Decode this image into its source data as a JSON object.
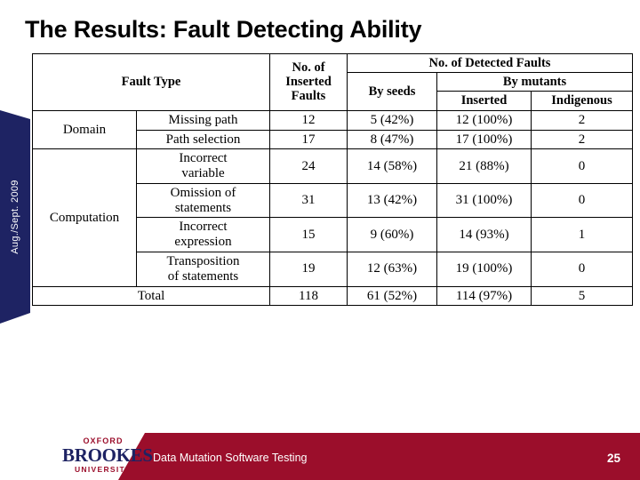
{
  "slide": {
    "title": "The Results: Fault Detecting Ability",
    "side_banner_label": "Aug./Sept. 2009",
    "page_number": "25"
  },
  "footer": {
    "text": "Data Mutation Software Testing",
    "logo_line1": "OXFORD",
    "logo_line2": "BROOKES",
    "logo_line3": "UNIVERSITY",
    "band_color": "#9b0e2b",
    "logo_navy": "#1e2363"
  },
  "chart_data": {
    "type": "table",
    "title": "The Results: Fault Detecting Ability",
    "headers": {
      "fault_type": "Fault Type",
      "inserted_faults": "No. of Inserted Faults",
      "inserted_faults_l1": "No. of",
      "inserted_faults_l2": "Inserted",
      "inserted_faults_l3": "Faults",
      "detected_faults": "No. of Detected Faults",
      "by_seeds": "By seeds",
      "by_mutants": "By mutants",
      "mutants_inserted": "Inserted",
      "mutants_indigenous": "Indigenous"
    },
    "columns": [
      "Fault Type Category",
      "Fault Type",
      "No. of Inserted Faults",
      "By seeds",
      "By mutants - Inserted",
      "By mutants - Indigenous"
    ],
    "rows": [
      {
        "category": "Domain",
        "category_rowspan": 2,
        "subtype": "Missing path",
        "inserted": "12",
        "by_seeds": "5 (42%)",
        "mut_inserted": "12 (100%)",
        "mut_indigenous": "2"
      },
      {
        "category": "",
        "subtype": "Path selection",
        "inserted": "17",
        "by_seeds": "8 (47%)",
        "mut_inserted": "17 (100%)",
        "mut_indigenous": "2"
      },
      {
        "category": "Computation",
        "category_rowspan": 4,
        "subtype": "Incorrect variable",
        "subtype_l1": "Incorrect",
        "subtype_l2": "variable",
        "inserted": "24",
        "by_seeds": "14 (58%)",
        "mut_inserted": "21 (88%)",
        "mut_indigenous": "0"
      },
      {
        "category": "",
        "subtype": "Omission of statements",
        "subtype_l1": "Omission of",
        "subtype_l2": "statements",
        "inserted": "31",
        "by_seeds": "13 (42%)",
        "mut_inserted": "31 (100%)",
        "mut_indigenous": "0"
      },
      {
        "category": "",
        "subtype": "Incorrect expression",
        "subtype_l1": "Incorrect",
        "subtype_l2": "expression",
        "inserted": "15",
        "by_seeds": "9 (60%)",
        "mut_inserted": "14 (93%)",
        "mut_indigenous": "1"
      },
      {
        "category": "",
        "subtype": "Transposition of statements",
        "subtype_l1": "Transposition",
        "subtype_l2": "of statements",
        "inserted": "19",
        "by_seeds": "12 (63%)",
        "mut_inserted": "19 (100%)",
        "mut_indigenous": "0"
      }
    ],
    "total_row": {
      "label": "Total",
      "inserted": "118",
      "by_seeds": "61 (52%)",
      "mut_inserted": "114 (97%)",
      "mut_indigenous": "5"
    }
  }
}
